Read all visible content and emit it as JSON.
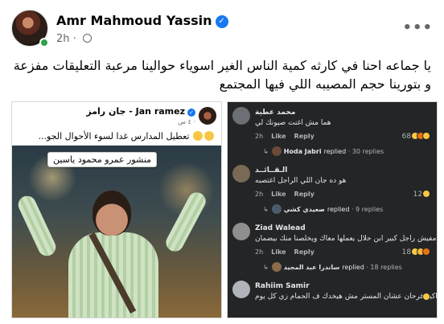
{
  "post": {
    "author": "Amr Mahmoud Yassin",
    "time": "2h",
    "more": "•••",
    "text": "يا جماعه احنا في كارثه كمية الناس الغير اسوياء حوالينا مرعبة  التعليقات مفزعة و بتورينا حجم المصيبه اللي فيها المجتمع"
  },
  "left_screenshot": {
    "page_name": "Jan ramez - جان رامز",
    "meta": "٤ س · ",
    "post_text": "تعطيل المدارس غدا لسوء الأحوال الجو...",
    "caption": "منشور عمرو محمود ياسين"
  },
  "comments": [
    {
      "name": "محمد عطية",
      "text": "هما مش اغنت صيونك لي",
      "time": "2h",
      "like": "Like",
      "reply": "Reply",
      "count": "68",
      "reactions": [
        "haha",
        "angry",
        "haha"
      ],
      "reply_name": "Hoda Jabri",
      "reply_label": "replied",
      "reply_count": "· 30 replies"
    },
    {
      "name": "الـقــائــد",
      "text": "هو ده جان اللي الراجل اغتصبه",
      "time": "2h",
      "like": "Like",
      "reply": "Reply",
      "count": "12",
      "reactions": [
        "haha"
      ],
      "reply_name": "صعيدي كشي",
      "reply_label": "replied",
      "reply_count": "· 9 replies"
    },
    {
      "name": "Ziad Walead",
      "text": "مفيش راجل كبير ابن حلال يعملها معاك ويخلصنا منك بيضمان",
      "time": "2h",
      "like": "Like",
      "reply": "Reply",
      "count": "18",
      "reactions": [
        "haha",
        "sad",
        "angry"
      ],
      "reply_name": "ساندرا عبد المجيد",
      "reply_label": "replied",
      "reply_count": "· 18 replies"
    },
    {
      "name": "Rahiim Samir",
      "text": "اكيد فرحان عشان المستر مش هيخدك ف الحمام زي كل يوم",
      "time": "",
      "like": "",
      "reply": "",
      "count": "",
      "reactions": [
        "haha"
      ],
      "reply_name": "",
      "reply_label": "",
      "reply_count": ""
    }
  ]
}
